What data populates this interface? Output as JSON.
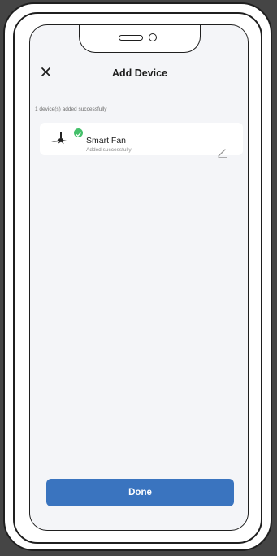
{
  "header": {
    "title": "Add Device",
    "close_icon": "close-icon"
  },
  "summary": {
    "success_text": "1 device(s) added successfully"
  },
  "devices": [
    {
      "name": "Smart Fan",
      "status": "Added successfully",
      "icon": "ceiling-fan-icon",
      "badge_icon": "check-badge-icon",
      "edit_icon": "edit-pencil-icon"
    }
  ],
  "footer": {
    "done_label": "Done"
  },
  "colors": {
    "accent": "#3a74bf",
    "success": "#44c06a",
    "screen_bg": "#f4f5f8",
    "card_bg": "#ffffff",
    "frame_bg": "#454545"
  }
}
